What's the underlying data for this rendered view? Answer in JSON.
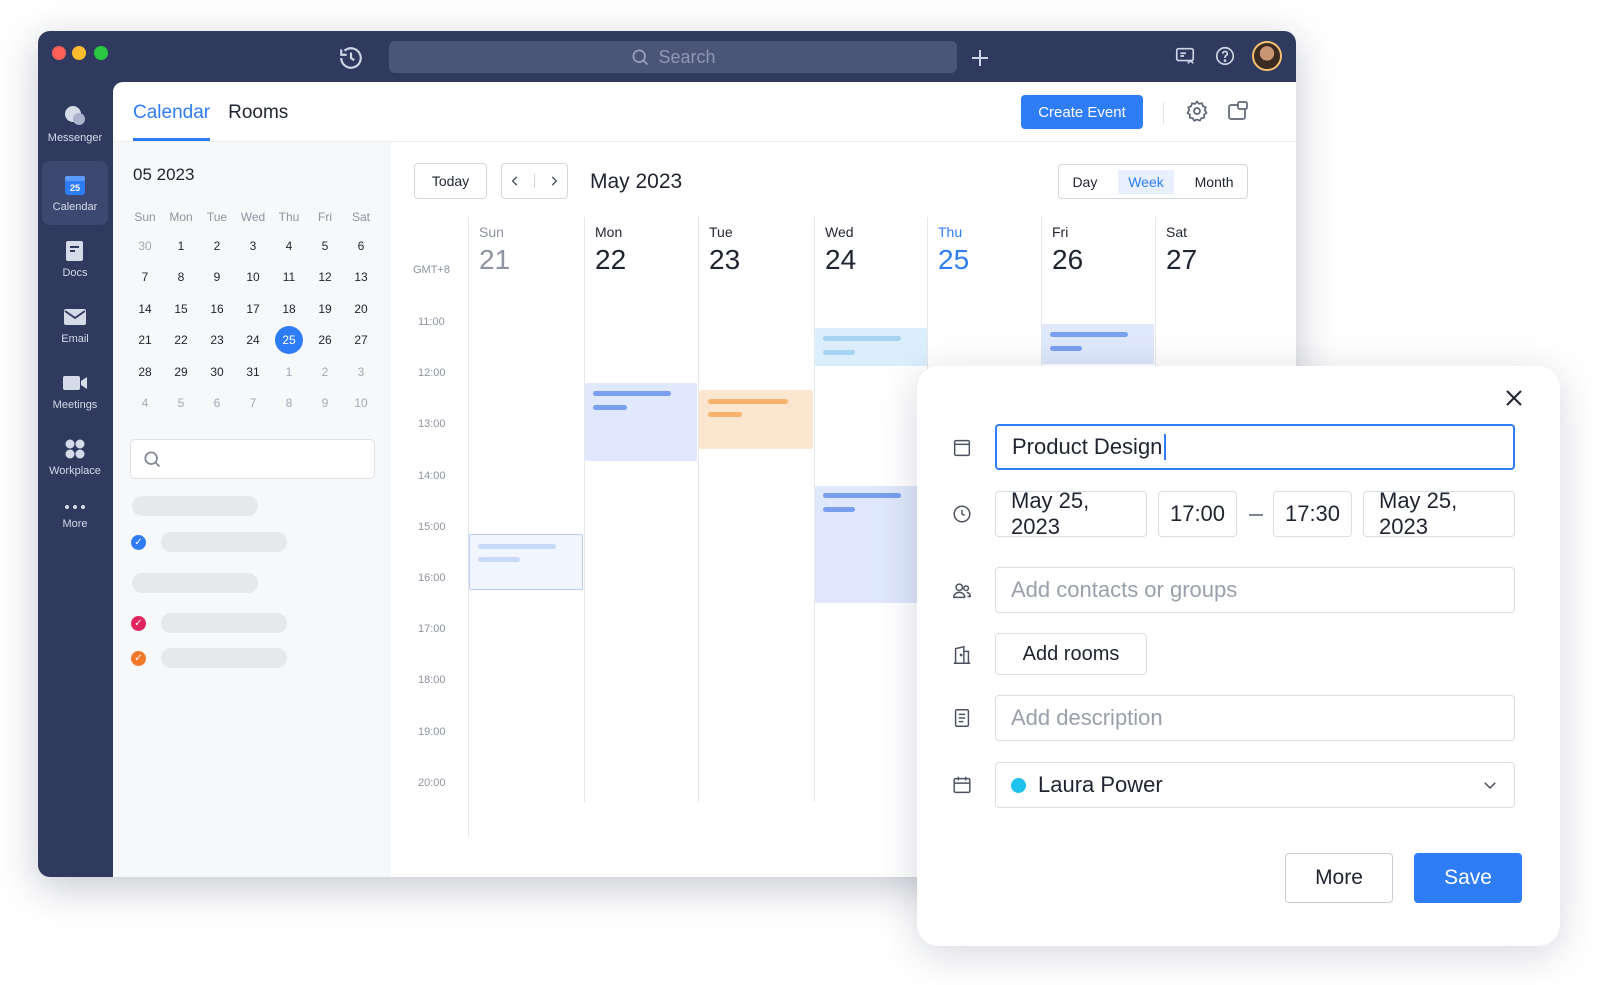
{
  "titlebar": {
    "search_placeholder": "Search"
  },
  "leftnav": {
    "items": [
      {
        "label": "Messenger"
      },
      {
        "label": "Calendar",
        "badge": "25"
      },
      {
        "label": "Docs"
      },
      {
        "label": "Email"
      },
      {
        "label": "Meetings"
      },
      {
        "label": "Workplace"
      },
      {
        "label": "More"
      }
    ]
  },
  "header": {
    "tabs": [
      "Calendar",
      "Rooms"
    ],
    "create_event": "Create Event"
  },
  "mini_calendar": {
    "title": "05 2023",
    "weekdays": [
      "Sun",
      "Mon",
      "Tue",
      "Wed",
      "Thu",
      "Fri",
      "Sat"
    ],
    "days": [
      [
        "30",
        "1",
        "2",
        "3",
        "4",
        "5",
        "6"
      ],
      [
        "7",
        "8",
        "9",
        "10",
        "11",
        "12",
        "13"
      ],
      [
        "14",
        "15",
        "16",
        "17",
        "18",
        "19",
        "20"
      ],
      [
        "21",
        "22",
        "23",
        "24",
        "25",
        "26",
        "27"
      ],
      [
        "28",
        "29",
        "30",
        "31",
        "1",
        "2",
        "3"
      ],
      [
        "4",
        "5",
        "6",
        "7",
        "8",
        "9",
        "10"
      ]
    ],
    "selected": "25"
  },
  "week_view": {
    "today_label": "Today",
    "month_label": "May 2023",
    "views": [
      "Day",
      "Week",
      "Month"
    ],
    "active_view": "Week",
    "timezone": "GMT+8",
    "hours": [
      "11:00",
      "12:00",
      "13:00",
      "14:00",
      "15:00",
      "16:00",
      "17:00",
      "18:00",
      "19:00",
      "20:00"
    ],
    "days": [
      {
        "name": "Sun",
        "date": "21"
      },
      {
        "name": "Mon",
        "date": "22"
      },
      {
        "name": "Tue",
        "date": "23"
      },
      {
        "name": "Wed",
        "date": "24"
      },
      {
        "name": "Thu",
        "date": "25"
      },
      {
        "name": "Fri",
        "date": "26"
      },
      {
        "name": "Sat",
        "date": "27"
      }
    ]
  },
  "event_form": {
    "title_value": "Product Design",
    "start_date": "May 25, 2023",
    "start_time": "17:00",
    "end_time": "17:30",
    "end_date": "May 25, 2023",
    "contacts_placeholder": "Add contacts or groups",
    "rooms_label": "Add rooms",
    "description_placeholder": "Add description",
    "calendar_owner": "Laura Power",
    "calendar_color": "#1ec2ee",
    "more_label": "More",
    "save_label": "Save"
  },
  "colors": {
    "accent": "#2f7df6",
    "sidebar": "#2f3a5e"
  }
}
